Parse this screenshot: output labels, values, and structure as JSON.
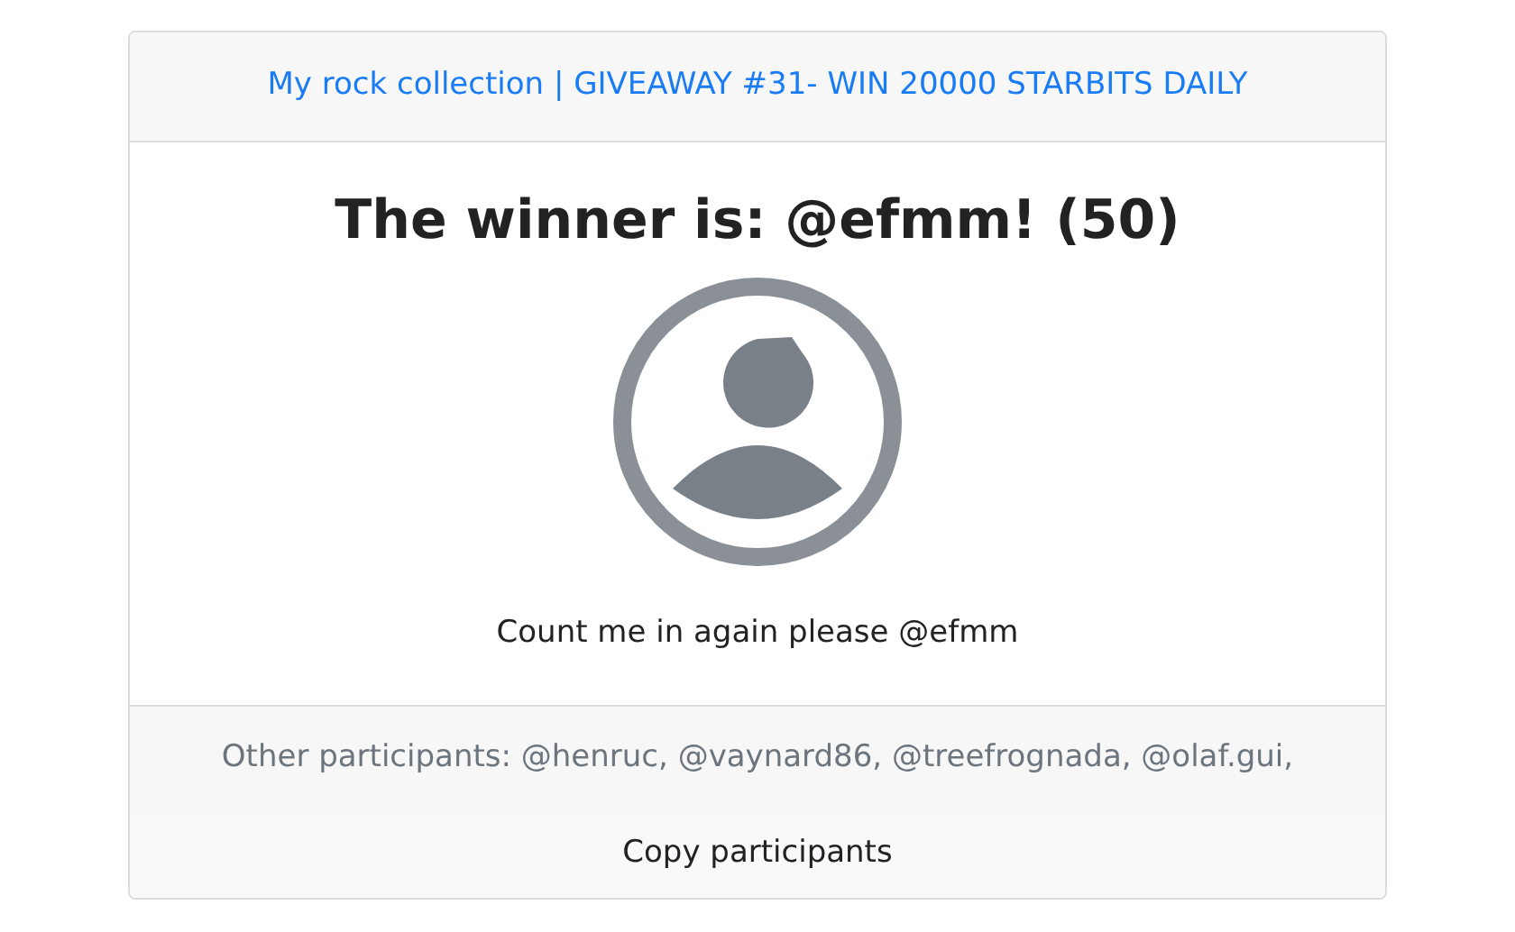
{
  "header": {
    "link": "My rock collection | GIVEAWAY #31- WIN 20000 STARBITS DAILY"
  },
  "winner": {
    "title": "The winner is: @efmm! (50)",
    "comment": "Count me in again please @efmm"
  },
  "footer": {
    "participants": "Other participants: @henruc, @vaynard86, @treefrognada, @olaf.gui,",
    "button": "Copy participants"
  }
}
